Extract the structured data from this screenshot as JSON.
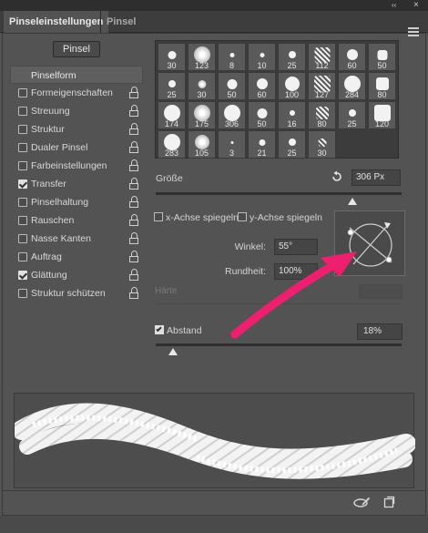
{
  "window": {
    "collapse_glyph": "‹‹",
    "close_glyph": "×"
  },
  "tabs": [
    {
      "label": "Pinseleinstellungen",
      "active": true
    },
    {
      "label": "Pinsel",
      "active": false
    }
  ],
  "pinsel_button": {
    "label": "Pinsel"
  },
  "left_list": {
    "header": "Pinselform",
    "items": [
      {
        "label": "Formeigenschaften",
        "checked": false
      },
      {
        "label": "Streuung",
        "checked": false
      },
      {
        "label": "Struktur",
        "checked": false
      },
      {
        "label": "Dualer Pinsel",
        "checked": false
      },
      {
        "label": "Farbeinstellungen",
        "checked": false
      },
      {
        "label": "Transfer",
        "checked": true
      },
      {
        "label": "Pinselhaltung",
        "checked": false
      },
      {
        "label": "Rauschen",
        "checked": false
      },
      {
        "label": "Nasse Kanten",
        "checked": false
      },
      {
        "label": "Auftrag",
        "checked": false
      },
      {
        "label": "Glättung",
        "checked": true
      },
      {
        "label": "Struktur schützen",
        "checked": false
      }
    ]
  },
  "brush_presets": [
    [
      "30",
      "123",
      "8",
      "10",
      "25",
      "112",
      "60",
      "50"
    ],
    [
      "25",
      "30",
      "50",
      "60",
      "100",
      "127",
      "284",
      "80"
    ],
    [
      "174",
      "175",
      "306",
      "50",
      "16",
      "80",
      "25",
      "120"
    ],
    [
      "283",
      "105",
      "3",
      "21",
      "25",
      "30"
    ]
  ],
  "size": {
    "label": "Größe",
    "value": "306 Px",
    "slider_fraction": 0.8
  },
  "flip": {
    "x_label": "x-Achse spiegeln",
    "y_label": "y-Achse spiegeln"
  },
  "angle": {
    "label": "Winkel:",
    "value": "55°"
  },
  "roundness": {
    "label": "Rundheit:",
    "value": "100%"
  },
  "hardness": {
    "label": "Härte"
  },
  "spacing": {
    "label": "Abstand",
    "checked": true,
    "value": "18%",
    "slider_fraction": 0.07
  },
  "colors": {
    "panel": "#535353",
    "accent_arrow": "#ee1f6f"
  }
}
